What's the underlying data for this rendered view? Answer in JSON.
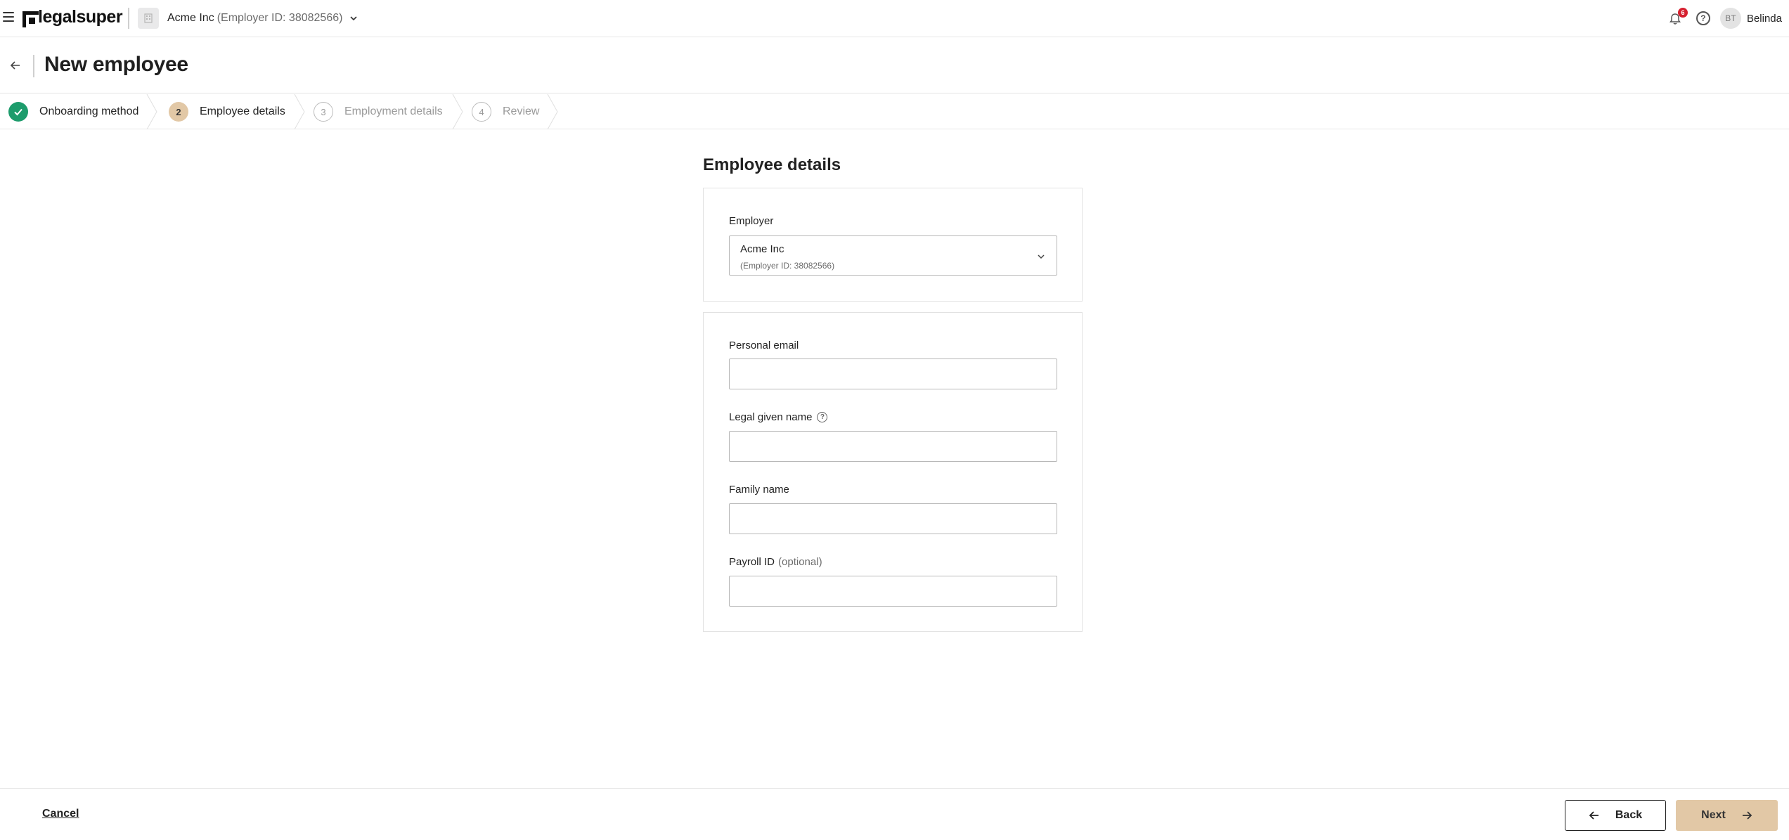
{
  "app": {
    "logo_text": "legalsuper"
  },
  "topbar": {
    "employer_name": "Acme Inc",
    "employer_id": "(Employer ID: 38082566)",
    "notification_count": "6",
    "user_initials": "BT",
    "user_name": "Belinda"
  },
  "page": {
    "title": "New employee"
  },
  "stepper": {
    "steps": [
      {
        "number": "",
        "label": "Onboarding method",
        "state": "done"
      },
      {
        "number": "2",
        "label": "Employee details",
        "state": "current"
      },
      {
        "number": "3",
        "label": "Employment details",
        "state": "future"
      },
      {
        "number": "4",
        "label": "Review",
        "state": "future"
      }
    ]
  },
  "form": {
    "section_title": "Employee details",
    "employer": {
      "label": "Employer",
      "selected_name": "Acme Inc",
      "selected_id": "(Employer ID: 38082566)"
    },
    "personal_email": {
      "label": "Personal email",
      "value": "",
      "placeholder": ""
    },
    "given_name": {
      "label": "Legal given name",
      "value": "",
      "placeholder": ""
    },
    "family_name": {
      "label": "Family name",
      "value": "",
      "placeholder": ""
    },
    "payroll_id": {
      "label": "Payroll ID",
      "optional": "(optional)",
      "value": "",
      "placeholder": ""
    }
  },
  "footer": {
    "cancel_label": "Cancel",
    "back_label": "Back",
    "next_label": "Next"
  },
  "colors": {
    "accent": "#e2c8a6",
    "success": "#1d9c6c",
    "badge": "#d6202f"
  },
  "icons": {
    "menu": "hamburger-icon",
    "building": "building-icon",
    "bell": "bell-icon",
    "help": "help-icon",
    "back": "arrow-left-icon",
    "next": "arrow-right-icon",
    "check": "check-icon",
    "chevron": "chevron-down-icon",
    "info": "info-icon"
  }
}
